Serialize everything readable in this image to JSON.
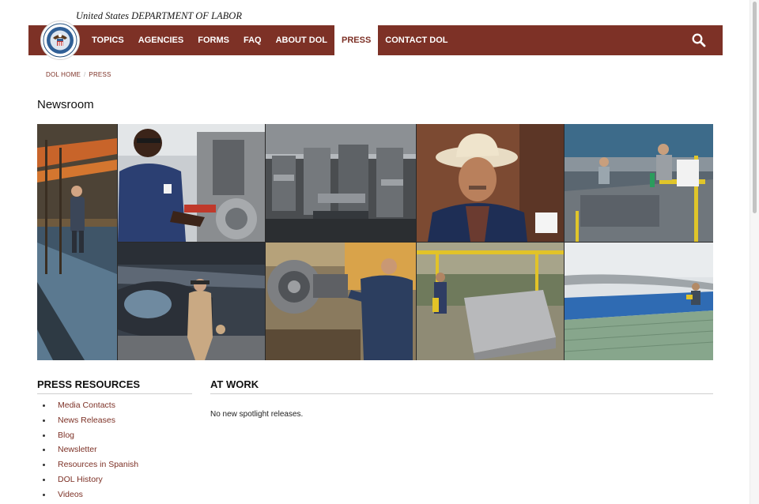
{
  "header": {
    "agency_name": "United States DEPARTMENT OF LABOR",
    "brand_color": "#7d3126"
  },
  "nav": {
    "items": [
      {
        "label": "TOPICS",
        "active": false
      },
      {
        "label": "AGENCIES",
        "active": false
      },
      {
        "label": "FORMS",
        "active": false
      },
      {
        "label": "FAQ",
        "active": false
      },
      {
        "label": "ABOUT DOL",
        "active": false
      },
      {
        "label": "PRESS",
        "active": true
      },
      {
        "label": "CONTACT DOL",
        "active": false
      }
    ],
    "search_icon": "search-icon"
  },
  "breadcrumb": {
    "home": "DOL HOME",
    "current": "PRESS"
  },
  "page": {
    "title": "Newsroom"
  },
  "mosaic": {
    "photos": [
      "Worker in warehouse with chains",
      "Machinist in blue shirt at mill",
      "Rows of milling machines",
      "Man in cowboy hat",
      "Workers at factory tables",
      "Pilot beside helicopter in hangar",
      "Mechanic working on wheel assembly",
      "Industrial metal fabrication shop",
      "Construction rebar work on bridge"
    ]
  },
  "press_resources": {
    "heading": "PRESS RESOURCES",
    "links": [
      "Media Contacts",
      "News Releases",
      "Blog",
      "Newsletter",
      "Resources in Spanish",
      "DOL History",
      "Videos"
    ]
  },
  "at_work": {
    "heading": "AT WORK",
    "message": "No new spotlight releases."
  }
}
